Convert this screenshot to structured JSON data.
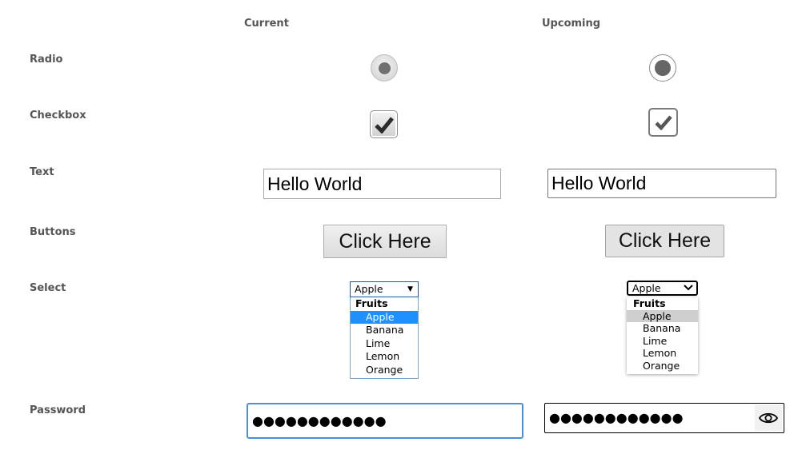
{
  "header": {
    "current": "Current",
    "upcoming": "Upcoming"
  },
  "rows": {
    "radio": "Radio",
    "checkbox": "Checkbox",
    "text": "Text",
    "buttons": "Buttons",
    "select": "Select",
    "password": "Password"
  },
  "text_value": "Hello World",
  "button_label": "Click Here",
  "select": {
    "value": "Apple",
    "group": "Fruits",
    "options": [
      "Apple",
      "Banana",
      "Lime",
      "Lemon",
      "Orange"
    ]
  },
  "password_masked": "●●●●●●●●●●●●",
  "icons": {
    "checkmark": "check-icon",
    "dropdown": "chevron-down-icon",
    "reveal": "eye-icon"
  },
  "colors": {
    "label": "#555555",
    "focus": "#4a90d9",
    "highlight_current": "#1e90ff",
    "highlight_upcoming": "#cfcfcf"
  }
}
